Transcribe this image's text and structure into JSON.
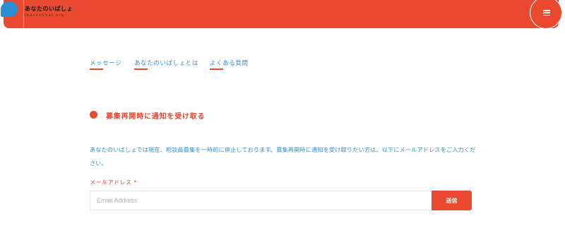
{
  "header": {
    "logo_title": "あなたのいばしょ",
    "logo_subtitle": "IbashoChat.org",
    "menu_icon": "hamburger-menu-icon",
    "brand_color": "#e8492f",
    "logo_color": "#2b8fd6"
  },
  "tabs": [
    {
      "label": "メッセージ"
    },
    {
      "label": "あなたのいばしょとは"
    },
    {
      "label": "よくある質問"
    }
  ],
  "section": {
    "title": "募集再開時に通知を受け取る"
  },
  "body": {
    "text": "あなたのいばしょでは現在、相談員募集を一時的に停止しております。募集再開時に通知を受け取りたい方は、以下にメールアドレスをご入力ください。"
  },
  "form": {
    "email_label": "メールアドレス *",
    "email_placeholder": "Email Address",
    "email_value": "",
    "submit_label": "送信"
  }
}
